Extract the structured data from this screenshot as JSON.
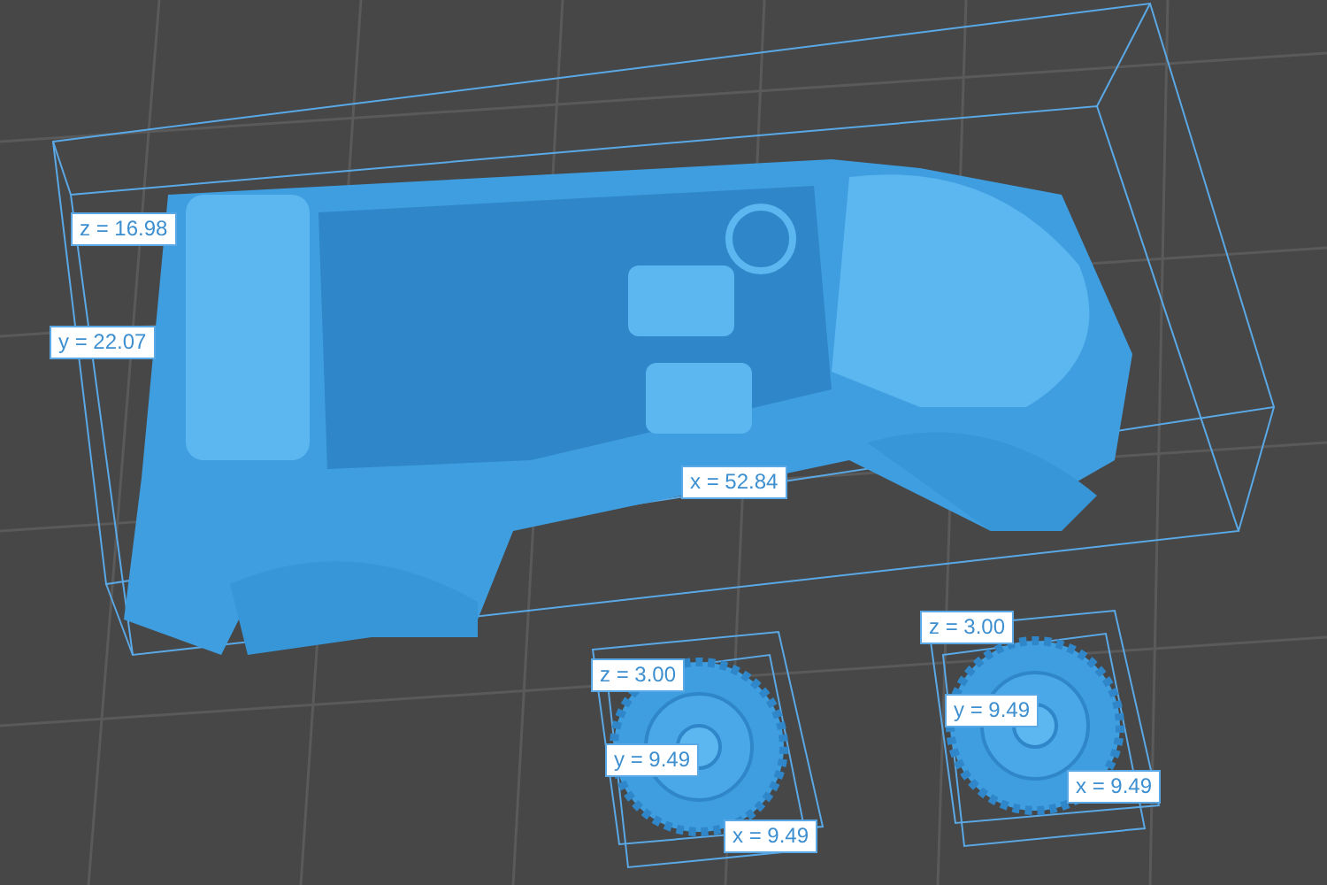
{
  "objects": [
    {
      "kind": "vehicle",
      "labels": [
        "z = 16.98",
        "y = 22.07",
        "x = 52.84"
      ]
    },
    {
      "kind": "wheel",
      "labels": [
        "z = 3.00",
        "y = 9.49",
        "x = 9.49"
      ]
    },
    {
      "kind": "wheel",
      "labels": [
        "z = 3.00",
        "y = 9.49",
        "x = 9.49"
      ]
    }
  ]
}
